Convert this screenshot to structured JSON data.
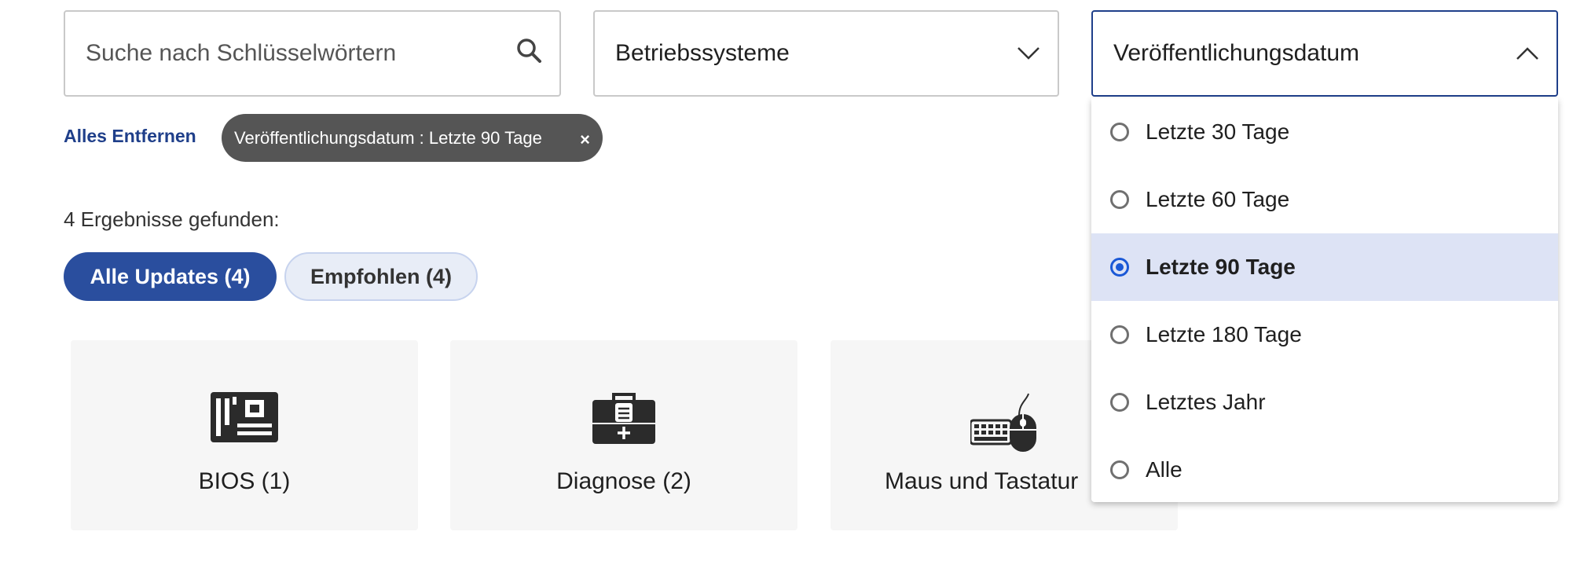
{
  "search": {
    "placeholder": "Suche nach Schlüsselwörtern",
    "icon": "search-icon"
  },
  "os_select": {
    "label": "Betriebssysteme",
    "icon": "chevron-down-icon"
  },
  "date_select": {
    "label": "Veröffentlichungsdatum",
    "icon": "chevron-up-icon",
    "expanded": true
  },
  "filters": {
    "clear_all": "Alles Entfernen",
    "active_chip": "Veröffentlichungsdatum : Letzte 90 Tage",
    "chip_close": "×"
  },
  "results": {
    "count_text": "4 Ergebnisse gefunden:",
    "tabs": [
      {
        "label": "Alle Updates (4)",
        "active": true
      },
      {
        "label": "Empfohlen (4)",
        "active": false
      }
    ]
  },
  "categories": [
    {
      "label": "BIOS (1)",
      "icon": "motherboard-icon"
    },
    {
      "label": "Diagnose (2)",
      "icon": "toolbox-icon"
    },
    {
      "label": "Maus und Tastatur",
      "icon": "keyboard-mouse-icon"
    }
  ],
  "date_options": [
    {
      "label": "Letzte 30 Tage",
      "selected": false
    },
    {
      "label": "Letzte 60 Tage",
      "selected": false
    },
    {
      "label": "Letzte 90 Tage",
      "selected": true
    },
    {
      "label": "Letzte 180 Tage",
      "selected": false
    },
    {
      "label": "Letztes Jahr",
      "selected": false
    },
    {
      "label": "Alle",
      "selected": false
    }
  ],
  "colors": {
    "accent": "#2a4e9e",
    "link": "#1f3f8a",
    "chip": "#555555",
    "selected_bg": "#dde3f5",
    "radio_selected": "#1a58d6"
  }
}
